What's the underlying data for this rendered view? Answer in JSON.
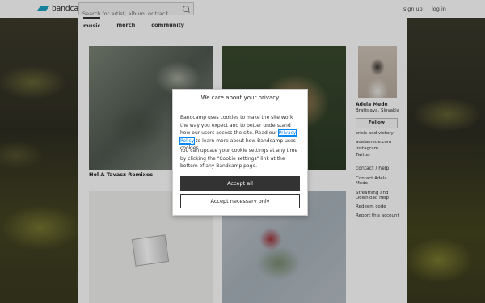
{
  "header": {
    "logo_text": "bandcamp",
    "search_placeholder": "Search for artist, album, or track",
    "signup": "sign up",
    "login": "log in"
  },
  "tabs": [
    "music",
    "merch",
    "community"
  ],
  "albums": [
    {
      "title": "Hol A Tavasz Remixes"
    }
  ],
  "artist": {
    "name": "Adela Mede",
    "location": "Bratislava, Slovakia",
    "follow_label": "Follow",
    "tagline": "crisis and victory",
    "links": [
      "adelamede.com",
      "Instagram",
      "Twitter"
    ],
    "contact_heading": "contact / help",
    "help_links": [
      "Contact Adela Mede",
      "Streaming and Download help",
      "Redeem code",
      "Report this account"
    ]
  },
  "modal": {
    "title": "We care about your privacy",
    "p1_before": "Bandcamp uses cookies to make the site work the way you expect and to better understand how our users access the site. Read our ",
    "p1_link": "Privacy Policy",
    "p1_after": " to learn more about how Bandcamp uses cookies.",
    "p2": "You can update your cookie settings at any time by clicking the \"Cookie settings\" link at the bottom of any Bandcamp page.",
    "accept_all": "Accept all",
    "accept_necessary": "Accept necessary only"
  }
}
